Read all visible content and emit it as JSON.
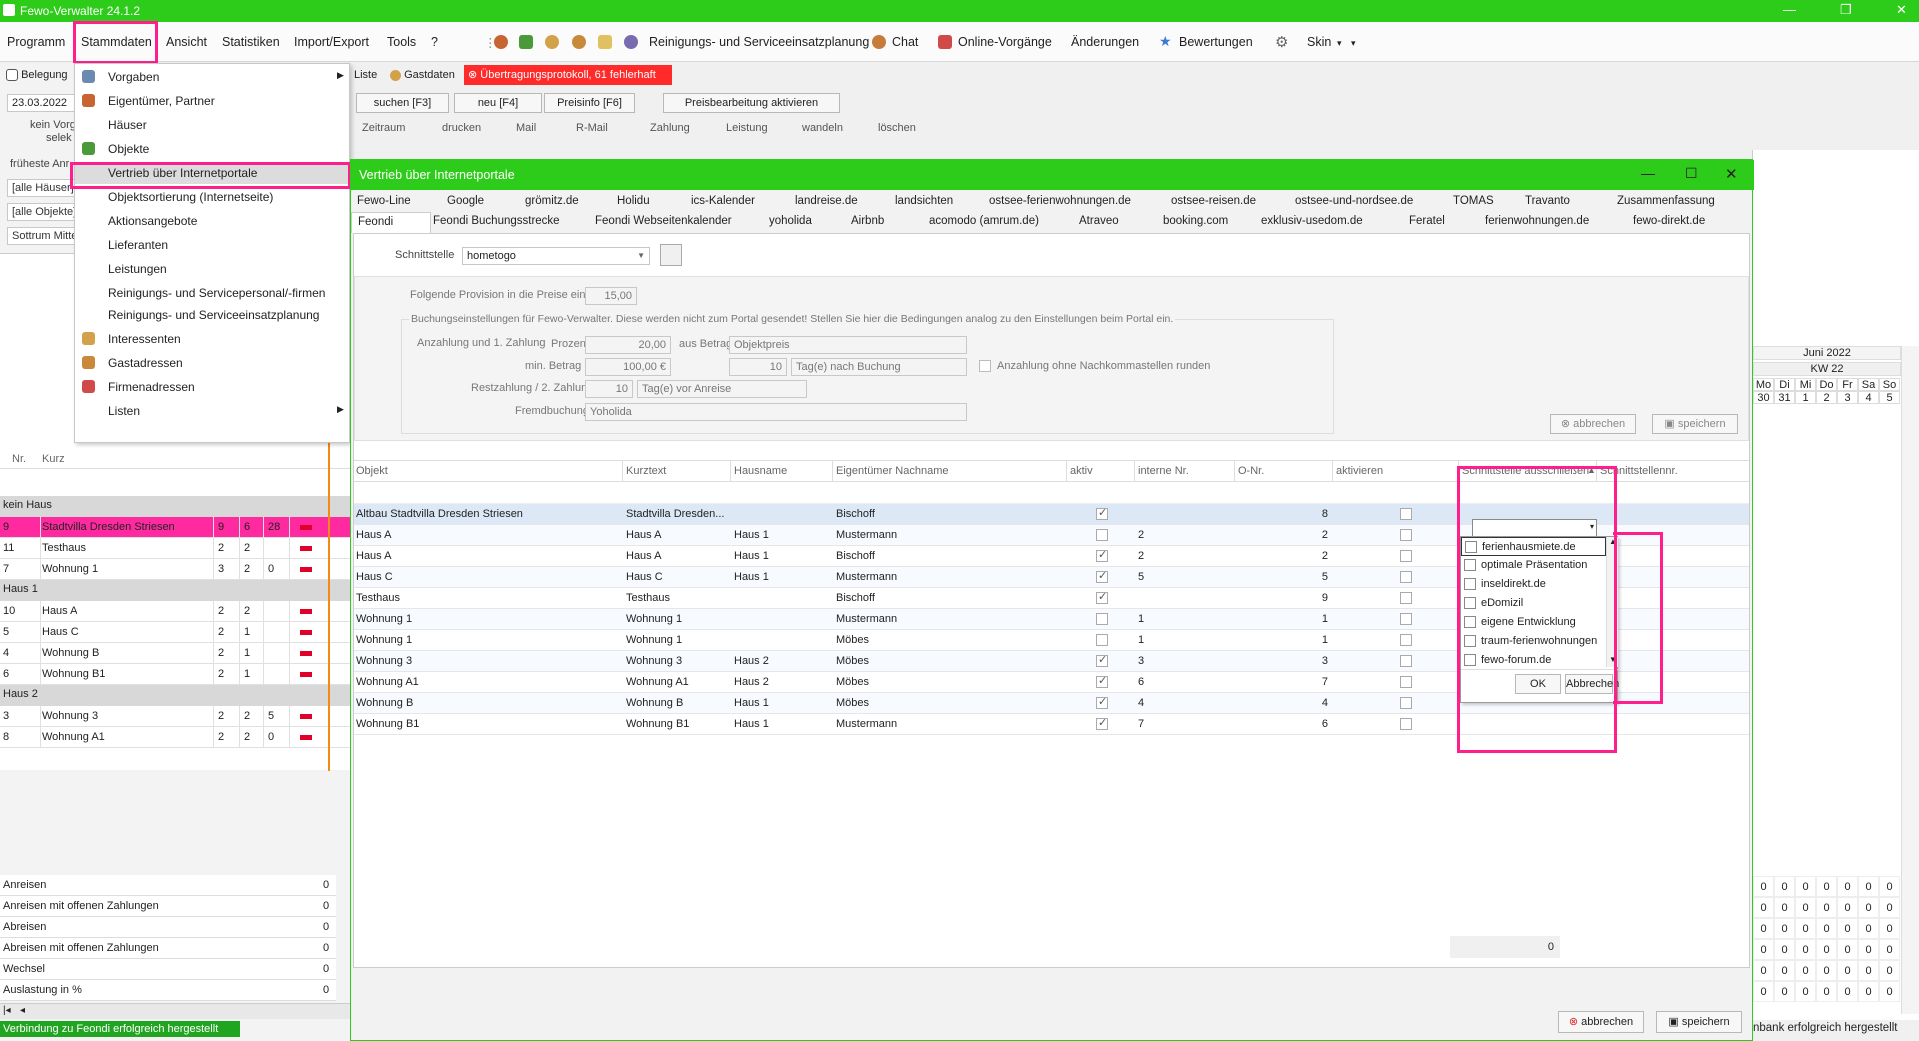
{
  "app": {
    "title": "Fewo-Verwalter 24.1.2"
  },
  "menubar": {
    "items": [
      "Programm",
      "Stammdaten",
      "Ansicht",
      "Statistiken",
      "Import/Export",
      "Tools",
      "?"
    ],
    "toolbar": {
      "reinigung": "Reinigungs- und Serviceeinsatzplanung",
      "chat": "Chat",
      "online": "Online-Vorgänge",
      "aenderungen": "Änderungen",
      "bewertungen": "Bewertungen",
      "skin": "Skin"
    }
  },
  "stammdaten_menu": {
    "items": [
      "Vorgaben",
      "Eigentümer, Partner",
      "Häuser",
      "Objekte",
      "Vertrieb über Internetportale",
      "Objektsortierung (Internetseite)",
      "Aktionsangebote",
      "Lieferanten",
      "Leistungen",
      "Reinigungs- und Servicepersonal/-firmen",
      "Reinigungs- und Serviceeinsatzplanung",
      "Interessenten",
      "Gastadressen",
      "Firmenadressen",
      "Listen"
    ]
  },
  "left_panel": {
    "belegung_tab": "Belegung",
    "date": "23.03.2022",
    "info1": "kein Vorg",
    "info2": "selek",
    "frueheste": "früheste Anr",
    "filter_haeuser": "[alle Häuser]",
    "filter_objekte": "[alle Objekte]",
    "filter_ort": "Sottrum Mitte",
    "col_nr": "Nr.",
    "col_kurz": "Kurz",
    "groups": [
      {
        "name": "kein Haus",
        "rows": [
          {
            "nr": "9",
            "kurz": "Stadtvilla Dresden Striesen",
            "a": "9",
            "b": "6",
            "c": "28",
            "selected": true
          },
          {
            "nr": "11",
            "kurz": "Testhaus",
            "a": "2",
            "b": "2",
            "c": ""
          },
          {
            "nr": "7",
            "kurz": "Wohnung 1",
            "a": "3",
            "b": "2",
            "c": "0"
          }
        ]
      },
      {
        "name": "Haus 1",
        "rows": [
          {
            "nr": "10",
            "kurz": "Haus A",
            "a": "2",
            "b": "2",
            "c": ""
          },
          {
            "nr": "5",
            "kurz": "Haus C",
            "a": "2",
            "b": "1",
            "c": ""
          },
          {
            "nr": "4",
            "kurz": "Wohnung B",
            "a": "2",
            "b": "1",
            "c": ""
          },
          {
            "nr": "6",
            "kurz": "Wohnung B1",
            "a": "2",
            "b": "1",
            "c": ""
          }
        ]
      },
      {
        "name": "Haus 2",
        "rows": [
          {
            "nr": "3",
            "kurz": "Wohnung 3",
            "a": "2",
            "b": "2",
            "c": "5"
          },
          {
            "nr": "8",
            "kurz": "Wohnung A1",
            "a": "2",
            "b": "2",
            "c": "0"
          }
        ]
      }
    ],
    "summary": [
      {
        "label": "Anreisen",
        "value": "0"
      },
      {
        "label": "Anreisen mit offenen Zahlungen",
        "value": "0"
      },
      {
        "label": "Abreisen",
        "value": "0"
      },
      {
        "label": "Abreisen mit offenen Zahlungen",
        "value": "0"
      },
      {
        "label": "Wechsel",
        "value": "0"
      },
      {
        "label": "Auslastung in %",
        "value": "0"
      }
    ],
    "status": "Verbindung zu Feondi erfolgreich hergestellt"
  },
  "back_toolbar": {
    "liste": "Liste",
    "gastdaten": "Gastdaten",
    "protokoll": "Übertragungsprotokoll, 61 fehlerhaft",
    "suchen": "suchen [F3]",
    "neu": "neu [F4]",
    "preisinfo": "Preisinfo [F6]",
    "preisbearbeitung": "Preisbearbeitung aktivieren",
    "row2": [
      "Zeitraum",
      "drucken",
      "Mail",
      "R-Mail",
      "Zahlung",
      "Leistung",
      "wandeln",
      "löschen"
    ]
  },
  "calendar": {
    "month": "Juni 2022",
    "week": "KW 22",
    "days": [
      "Mo",
      "Di",
      "Mi",
      "Do",
      "Fr",
      "Sa",
      "So"
    ],
    "dates": [
      "30",
      "31",
      "1",
      "2",
      "3",
      "4",
      "5"
    ],
    "status_right": "nbank erfolgreich hergestellt"
  },
  "dialog": {
    "title": "Vertrieb über Internetportale",
    "tabs_row1": [
      "Fewo-Line",
      "Google",
      "grömitz.de",
      "Holidu",
      "ics-Kalender",
      "landreise.de",
      "landsichten",
      "ostsee-ferienwohnungen.de",
      "ostsee-reisen.de",
      "ostsee-und-nordsee.de",
      "TOMAS",
      "Travanto",
      "Zusammenfassung"
    ],
    "tabs_row2": [
      "Feondi",
      "Feondi Buchungsstrecke",
      "Feondi Webseitenkalender",
      "yoholida",
      "Airbnb",
      "acomodo (amrum.de)",
      "Atraveo",
      "booking.com",
      "exklusiv-usedom.de",
      "Feratel",
      "ferienwohnungen.de",
      "fewo-direkt.de"
    ],
    "schnittstelle_label": "Schnittstelle",
    "schnittstelle_value": "hometogo",
    "provision_label": "Folgende Provision in die Preise einrechnen",
    "provision_value": "15,00",
    "buchung_legend": "Buchungseinstellungen für Fewo-Verwalter. Diese werden nicht zum Portal gesendet! Stellen Sie hier die Bedingungen analog zu den Einstellungen beim Portal ein.",
    "anzahlung_label": "Anzahlung und 1. Zahlung",
    "prozent_label": "Prozent",
    "prozent_value": "20,00",
    "aus_betrag_label": "aus Betrag",
    "aus_betrag_value": "Objektpreis",
    "min_betrag_label": "min. Betrag",
    "min_betrag_value": "100,00 €",
    "tage_value": "10",
    "tage_unit": "Tag(e) nach Buchung",
    "runden_label": "Anzahlung ohne Nachkommastellen runden",
    "rest_label": "Restzahlung / 2. Zahlung",
    "rest_value": "10",
    "rest_unit": "Tag(e) vor Anreise",
    "fremd_label": "Fremdbuchung",
    "fremd_value": "Yoholida",
    "abbrechen": "abbrechen",
    "speichern": "speichern",
    "grid": {
      "headers": [
        "Objekt",
        "Kurztext",
        "Hausname",
        "Eigentümer Nachname",
        "aktiv",
        "interne Nr.",
        "O-Nr.",
        "aktivieren",
        "Schnittstelle ausschließen",
        "Schnittstellennr."
      ],
      "rows": [
        {
          "objekt": "Altbau Stadtvilla Dresden Striesen",
          "kurz": "Stadtvilla Dresden...",
          "haus": "",
          "eig": "Bischoff",
          "aktiv": true,
          "intern": "",
          "onr": "8",
          "selected": true
        },
        {
          "objekt": "Haus A",
          "kurz": "Haus A",
          "haus": "Haus 1",
          "eig": "Mustermann",
          "aktiv": false,
          "intern": "2",
          "onr": "2"
        },
        {
          "objekt": "Haus A",
          "kurz": "Haus A",
          "haus": "Haus 1",
          "eig": "Bischoff",
          "aktiv": true,
          "intern": "2",
          "onr": "2"
        },
        {
          "objekt": "Haus C",
          "kurz": "Haus C",
          "haus": "Haus 1",
          "eig": "Mustermann",
          "aktiv": true,
          "intern": "5",
          "onr": "5"
        },
        {
          "objekt": "Testhaus",
          "kurz": "Testhaus",
          "haus": "",
          "eig": "Bischoff",
          "aktiv": true,
          "intern": "",
          "onr": "9"
        },
        {
          "objekt": "Wohnung 1",
          "kurz": "Wohnung 1",
          "haus": "",
          "eig": "Mustermann",
          "aktiv": false,
          "intern": "1",
          "onr": "1"
        },
        {
          "objekt": "Wohnung 1",
          "kurz": "Wohnung 1",
          "haus": "",
          "eig": "Möbes",
          "aktiv": false,
          "intern": "1",
          "onr": "1"
        },
        {
          "objekt": "Wohnung 3",
          "kurz": "Wohnung 3",
          "haus": "Haus 2",
          "eig": "Möbes",
          "aktiv": true,
          "intern": "3",
          "onr": "3"
        },
        {
          "objekt": "Wohnung A1",
          "kurz": "Wohnung A1",
          "haus": "Haus 2",
          "eig": "Möbes",
          "aktiv": true,
          "intern": "6",
          "onr": "7"
        },
        {
          "objekt": "Wohnung B",
          "kurz": "Wohnung B",
          "haus": "Haus 1",
          "eig": "Möbes",
          "aktiv": true,
          "intern": "4",
          "onr": "4"
        },
        {
          "objekt": "Wohnung B1",
          "kurz": "Wohnung B1",
          "haus": "Haus 1",
          "eig": "Mustermann",
          "aktiv": true,
          "intern": "7",
          "onr": "6"
        }
      ],
      "footer_count": "0"
    },
    "dropdown": {
      "options": [
        "ferienhausmiete.de",
        "optimale Präsentation",
        "inseldirekt.de",
        "eDomizil",
        "eigene Entwicklung",
        "traum-ferienwohnungen",
        "fewo-forum.de"
      ],
      "ok": "OK",
      "cancel": "Abbrechen"
    },
    "bottom_abbrechen": "abbrechen",
    "bottom_speichern": "speichern"
  },
  "colors": {
    "accent": "#2ecc1a",
    "highlight": "#ff1e8c",
    "selected_row": "#ff2aa0",
    "error": "#ff2a2a"
  }
}
